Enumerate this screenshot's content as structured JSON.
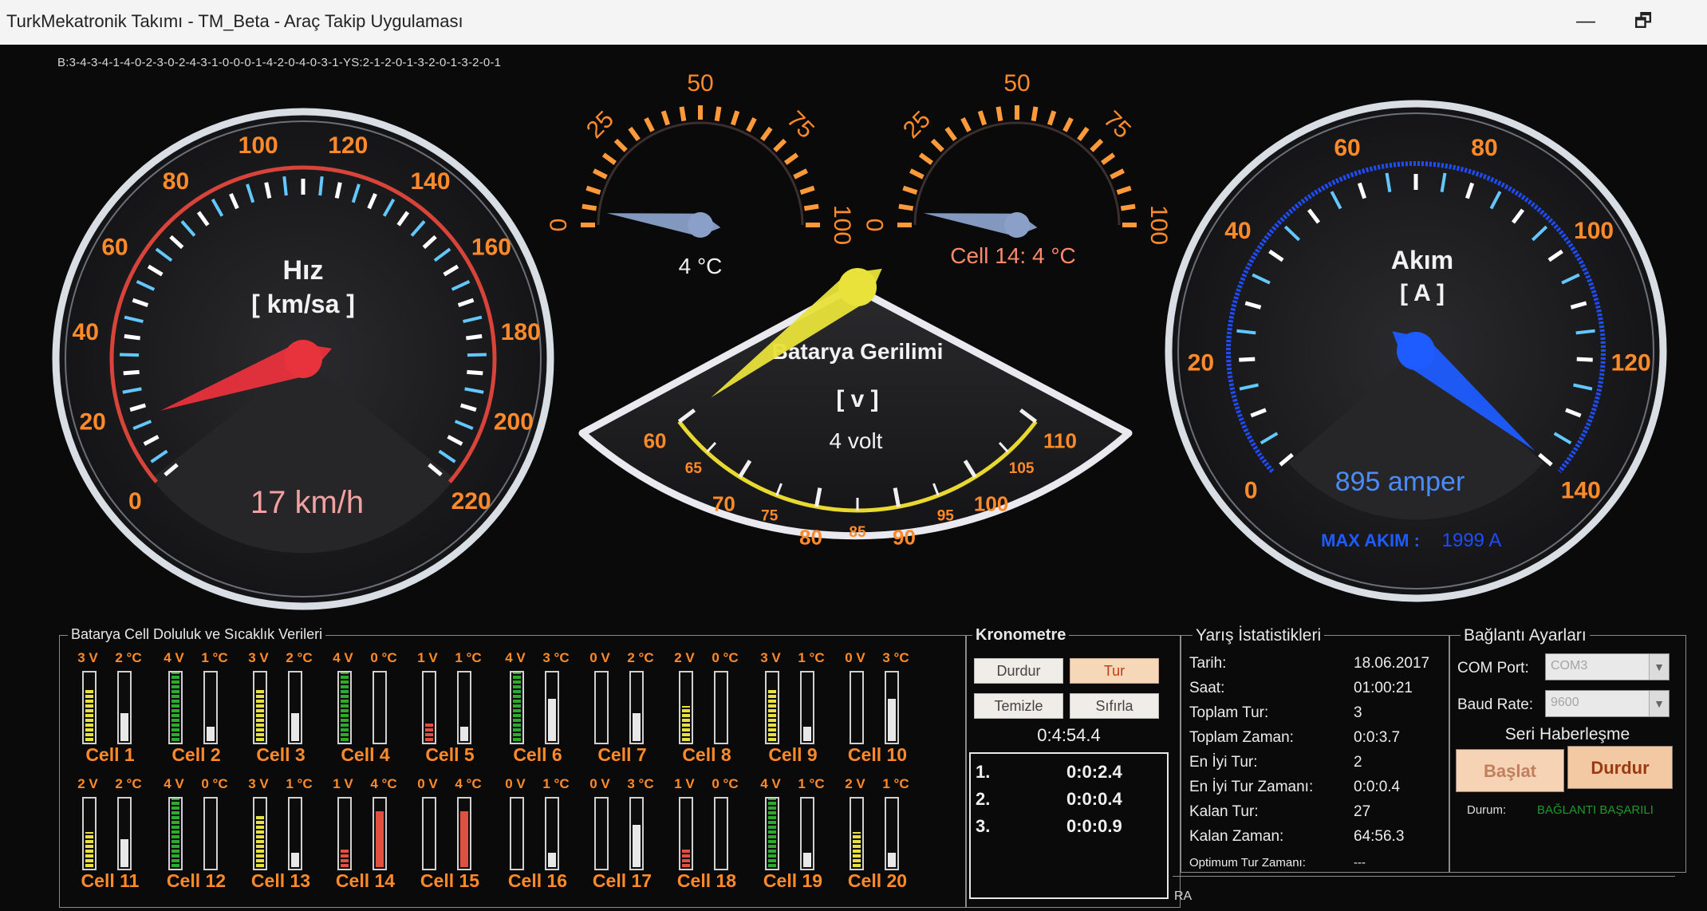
{
  "window": {
    "title": "TurkMekatronik Takımı - TM_Beta - Araç Takip Uygulaması",
    "restore_glyph": "🗗",
    "minimize_glyph": "—"
  },
  "code_string": "B:3-4-3-4-1-4-0-2-3-0-2-4-3-1-0-0-0-1-4-2-0-4-0-3-1-YS:2-1-2-0-1-3-2-0-1-3-2-0-1",
  "speed_gauge": {
    "title": "Hız",
    "unit": "[ km/sa ]",
    "value": 17,
    "readout": "17 km/h",
    "min": 0,
    "max": 220,
    "ticks": [
      "0",
      "20",
      "40",
      "60",
      "80",
      "100",
      "120",
      "140",
      "160",
      "180",
      "200",
      "220"
    ],
    "colors": {
      "needle": "#e8323c",
      "arc": "#d8443a",
      "ticks": "#ff8a2a"
    }
  },
  "temp_gauge_1": {
    "value": 4,
    "readout": "4 °C",
    "min": 0,
    "max": 100,
    "ticks": [
      "0",
      "25",
      "50",
      "75",
      "100"
    ]
  },
  "temp_gauge_2": {
    "value": 4,
    "readout": "Cell 14:  4 °C",
    "min": 0,
    "max": 100,
    "ticks": [
      "0",
      "25",
      "50",
      "75",
      "100"
    ]
  },
  "voltage_gauge": {
    "title": "Batarya Gerilimi",
    "unit": "[ v ]",
    "value": 4,
    "readout": "4 volt",
    "min": 60,
    "max": 110,
    "major_ticks": [
      "60",
      "70",
      "80",
      "90",
      "100",
      "110"
    ],
    "minor_ticks": [
      "65",
      "75",
      "85",
      "95",
      "105"
    ],
    "colors": {
      "needle": "#e8e23a",
      "arc": "#e8d830"
    }
  },
  "current_gauge": {
    "title": "Akım",
    "unit": "[ A ]",
    "value": 895,
    "readout": "895 amper",
    "max_label": "MAX AKIM :",
    "max_value": "1999 A",
    "min": 0,
    "max": 140,
    "ticks": [
      "0",
      "20",
      "40",
      "60",
      "80",
      "100",
      "120",
      "140"
    ],
    "colors": {
      "needle": "#1f5cff",
      "arc": "#1f4cff",
      "readout": "#4a8cff"
    }
  },
  "battery_panel": {
    "title": "Batarya Cell Doluluk ve Sıcaklık Verileri",
    "v_max": 4,
    "t_max": 5,
    "cells": [
      {
        "name": "Cell 1",
        "v": 3,
        "v_label": "3 V",
        "t": 2,
        "t_label": "2 °C"
      },
      {
        "name": "Cell 2",
        "v": 4,
        "v_label": "4 V",
        "t": 1,
        "t_label": "1 °C"
      },
      {
        "name": "Cell 3",
        "v": 3,
        "v_label": "3 V",
        "t": 2,
        "t_label": "2 °C"
      },
      {
        "name": "Cell 4",
        "v": 4,
        "v_label": "4 V",
        "t": 0,
        "t_label": "0 °C"
      },
      {
        "name": "Cell 5",
        "v": 1,
        "v_label": "1 V",
        "t": 1,
        "t_label": "1 °C"
      },
      {
        "name": "Cell 6",
        "v": 4,
        "v_label": "4 V",
        "t": 3,
        "t_label": "3 °C"
      },
      {
        "name": "Cell 7",
        "v": 0,
        "v_label": "0 V",
        "t": 2,
        "t_label": "2 °C"
      },
      {
        "name": "Cell 8",
        "v": 2,
        "v_label": "2 V",
        "t": 0,
        "t_label": "0 °C"
      },
      {
        "name": "Cell 9",
        "v": 3,
        "v_label": "3 V",
        "t": 1,
        "t_label": "1 °C"
      },
      {
        "name": "Cell 10",
        "v": 0,
        "v_label": "0 V",
        "t": 3,
        "t_label": "3 °C"
      },
      {
        "name": "Cell 11",
        "v": 2,
        "v_label": "2 V",
        "t": 2,
        "t_label": "2 °C"
      },
      {
        "name": "Cell 12",
        "v": 4,
        "v_label": "4 V",
        "t": 0,
        "t_label": "0 °C"
      },
      {
        "name": "Cell 13",
        "v": 3,
        "v_label": "3 V",
        "t": 1,
        "t_label": "1 °C"
      },
      {
        "name": "Cell 14",
        "v": 1,
        "v_label": "1 V",
        "t": 4,
        "t_label": "4 °C"
      },
      {
        "name": "Cell 15",
        "v": 0,
        "v_label": "0 V",
        "t": 4,
        "t_label": "4 °C"
      },
      {
        "name": "Cell 16",
        "v": 0,
        "v_label": "0 V",
        "t": 1,
        "t_label": "1 °C"
      },
      {
        "name": "Cell 17",
        "v": 0,
        "v_label": "0 V",
        "t": 3,
        "t_label": "3 °C"
      },
      {
        "name": "Cell 18",
        "v": 1,
        "v_label": "1 V",
        "t": 0,
        "t_label": "0 °C"
      },
      {
        "name": "Cell 19",
        "v": 4,
        "v_label": "4 V",
        "t": 1,
        "t_label": "1 °C"
      },
      {
        "name": "Cell 20",
        "v": 2,
        "v_label": "2 V",
        "t": 1,
        "t_label": "1 °C"
      }
    ]
  },
  "stopwatch": {
    "title": "Kronometre",
    "stop_label": "Durdur",
    "lap_label": "Tur",
    "clear_label": "Temizle",
    "reset_label": "Sıfırla",
    "time": "0:4:54.4",
    "laps": [
      {
        "n": "1.",
        "time": "0:0:2.4"
      },
      {
        "n": "2.",
        "time": "0:0:0.4"
      },
      {
        "n": "3.",
        "time": "0:0:0.9"
      }
    ]
  },
  "race_stats": {
    "title": "Yarış İstatistikleri",
    "rows": [
      {
        "label": "Tarih:",
        "value": "18.06.2017"
      },
      {
        "label": "Saat:",
        "value": "01:00:21"
      },
      {
        "label": "Toplam Tur:",
        "value": "3"
      },
      {
        "label": "Toplam Zaman:",
        "value": "0:0:3.7"
      },
      {
        "label": "En İyi Tur:",
        "value": "2"
      },
      {
        "label": "En İyi Tur Zamanı:",
        "value": "0:0:0.4"
      },
      {
        "label": "Kalan Tur:",
        "value": "27"
      },
      {
        "label": "Kalan Zaman:",
        "value": "64:56.3"
      },
      {
        "label": "Optimum Tur Zamanı:",
        "value": "---"
      }
    ]
  },
  "connection": {
    "title": "Bağlantı Ayarları",
    "port_label": "COM Port:",
    "port_value": "COM3",
    "baud_label": "Baud Rate:",
    "baud_value": "9600",
    "serial_title": "Seri Haberleşme",
    "start_label": "Başlat",
    "stop_label": "Durdur",
    "status_label": "Durum:",
    "status_value": "BAĞLANTI BAŞARILI",
    "status_color": "#1e9a2a"
  },
  "status_bar": {
    "text": "RA"
  }
}
